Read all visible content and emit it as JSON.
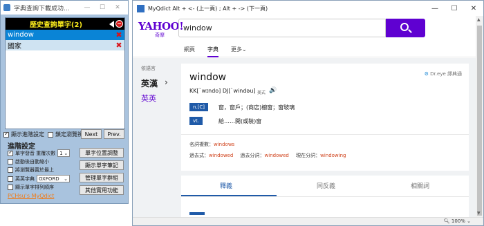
{
  "left_window": {
    "title": "字典查詢下載成功...",
    "history_header": "歷史查詢單字(2)",
    "words": [
      {
        "word": "window",
        "selected": true
      },
      {
        "word": "國家",
        "selected": false
      }
    ],
    "row1": {
      "show_advanced": "顯示進階設定",
      "lock_browser": "鎖定瀏覽視窗",
      "next": "Next",
      "prev": "Prev."
    },
    "advanced_title": "進階設定",
    "options": {
      "pronounce": "單字發音 重覆次數",
      "repeat_count": "1",
      "auto_minimize": "啟動後自動縮小",
      "browser_top": "將瀏覽器置於最上",
      "en_dict": "英英字典",
      "en_dict_value": "OXFORD",
      "show_sorted": "顯示單字排列順序",
      "link": "PCHsu's MyQdict"
    },
    "buttons": {
      "word_position": "單字位置調整",
      "show_notes": "顯示單字筆記",
      "manage_groups": "管理單字群組",
      "other_tools": "其他實用功能"
    }
  },
  "right_window": {
    "title": "MyQdict   Alt + <- (上一頁) ; Alt + -> (下一頁)",
    "logo": "YAHOO!",
    "logo_sub": "奇摩",
    "search_value": "window",
    "tabs": [
      "網頁",
      "字典",
      "更多⌄"
    ],
    "active_tab": "字典",
    "side": {
      "title": "依語言",
      "item1": "英漢",
      "item2": "英英"
    },
    "entry": {
      "word": "window",
      "provider": "Dr.eye 譯典通",
      "pron": "KK[ˋwɪndo]   DJ[ˋwindəu]",
      "pron_us": "美式",
      "senses": [
        {
          "pos": "n.[C]",
          "def": "窗，窗戶；(商店)櫥窗；窗玻璃"
        },
        {
          "pos": "vt.",
          "def": "給……開(或裝)窗"
        }
      ],
      "plural_label": "名詞複數：",
      "plural": "windows",
      "past_label": "過去式：",
      "past": "windowed",
      "pp_label": "過去分詞：",
      "pp": "windowed",
      "ing_label": "現在分詞：",
      "ing": "windowing"
    },
    "content_tabs": [
      "釋義",
      "同反義",
      "相關詞"
    ],
    "zoom": "100%"
  },
  "colors": {
    "yahoo_purple": "#5f01d1",
    "pos_blue": "#1f5aa8",
    "form_red": "#d0421b",
    "selected_row": "#0a84d6"
  }
}
